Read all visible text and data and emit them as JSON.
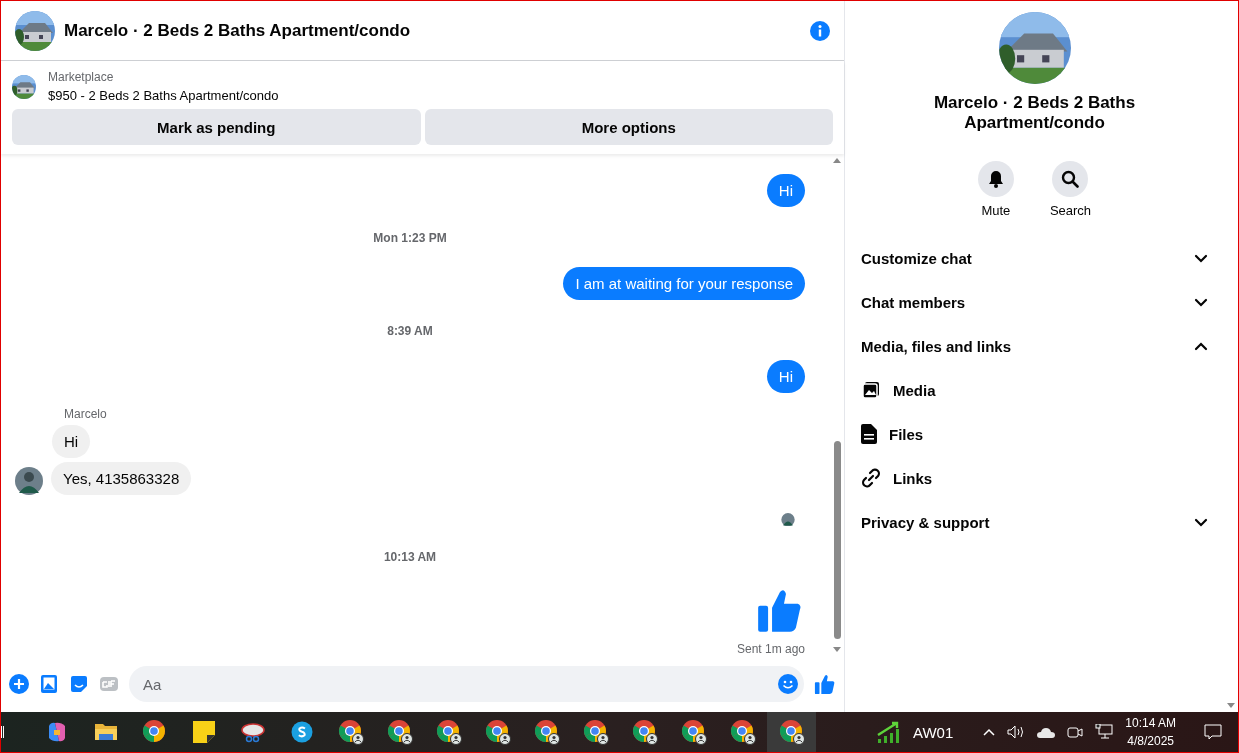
{
  "header": {
    "title": "Marcelo · 2 Beds 2 Baths Apartment/condo"
  },
  "listing": {
    "source": "Marketplace",
    "summary": "$950 - 2 Beds 2 Baths Apartment/condo",
    "buttons": [
      "Mark as pending",
      "More options"
    ]
  },
  "messages": [
    {
      "kind": "outgoing",
      "text": "Hi"
    },
    {
      "kind": "timestamp",
      "text": "Mon 1:23 PM"
    },
    {
      "kind": "outgoing",
      "text": "I am at waiting for your response"
    },
    {
      "kind": "timestamp",
      "text": "8:39 AM"
    },
    {
      "kind": "outgoing",
      "text": "Hi"
    },
    {
      "kind": "sender",
      "text": "Marcelo"
    },
    {
      "kind": "incoming",
      "text": "Hi",
      "avatar": false
    },
    {
      "kind": "incoming",
      "text": "Yes, 4135863328",
      "avatar": true
    },
    {
      "kind": "seen"
    },
    {
      "kind": "timestamp",
      "text": "10:13 AM"
    },
    {
      "kind": "like"
    },
    {
      "kind": "status",
      "text": "Sent 1m ago"
    }
  ],
  "composer": {
    "placeholder": "Aa"
  },
  "details": {
    "title": "Marcelo · 2 Beds 2 Baths Apartment/condo",
    "actions": [
      {
        "kind": "mute",
        "label": "Mute"
      },
      {
        "kind": "search",
        "label": "Search"
      }
    ],
    "sections": [
      {
        "label": "Customize chat",
        "expanded": false
      },
      {
        "label": "Chat members",
        "expanded": false
      },
      {
        "label": "Media, files and links",
        "expanded": true,
        "children": [
          {
            "kind": "media",
            "label": "Media"
          },
          {
            "kind": "files",
            "label": "Files"
          },
          {
            "kind": "links",
            "label": "Links"
          }
        ]
      },
      {
        "label": "Privacy & support",
        "expanded": false
      }
    ]
  },
  "taskbar": {
    "apps": [
      {
        "kind": "copilot",
        "selected": false
      },
      {
        "kind": "folder",
        "selected": false
      },
      {
        "kind": "chrome",
        "selected": false
      },
      {
        "kind": "notes",
        "selected": false
      },
      {
        "kind": "snip",
        "selected": false
      },
      {
        "kind": "skype",
        "selected": false
      },
      {
        "kind": "chrome-profile",
        "selected": false
      },
      {
        "kind": "chrome-profile",
        "selected": false
      },
      {
        "kind": "chrome-profile",
        "selected": false
      },
      {
        "kind": "chrome-profile",
        "selected": false
      },
      {
        "kind": "chrome-profile",
        "selected": false
      },
      {
        "kind": "chrome-profile",
        "selected": false
      },
      {
        "kind": "chrome-profile",
        "selected": false
      },
      {
        "kind": "chrome-profile",
        "selected": false
      },
      {
        "kind": "chrome-profile",
        "selected": false
      },
      {
        "kind": "chrome-profile",
        "selected": true
      }
    ],
    "stock": "AW01",
    "time": "10:14 AM",
    "date": "4/8/2025"
  }
}
